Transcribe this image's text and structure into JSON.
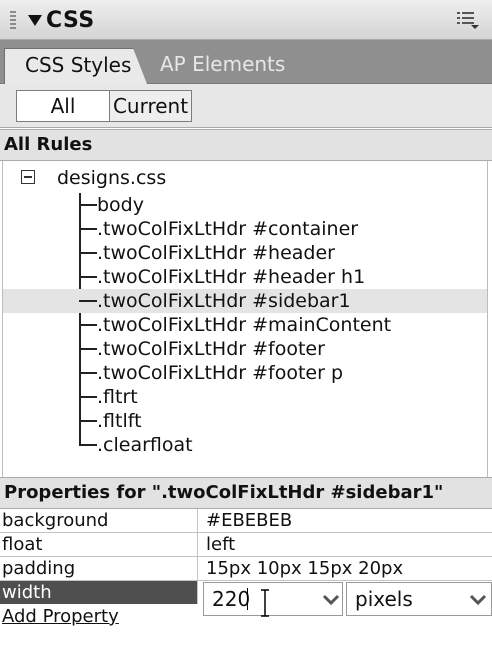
{
  "panel": {
    "title": "CSS"
  },
  "tabs": [
    {
      "label": "CSS Styles",
      "active": true
    },
    {
      "label": "AP Elements",
      "active": false
    }
  ],
  "mode_switch": {
    "all_label": "All",
    "current_label": "Current",
    "selected": "All"
  },
  "rules": {
    "header": "All Rules",
    "stylesheet": "designs.css",
    "items": [
      {
        "label": "body",
        "selected": false
      },
      {
        "label": ".twoColFixLtHdr #container",
        "selected": false
      },
      {
        "label": ".twoColFixLtHdr #header",
        "selected": false
      },
      {
        "label": ".twoColFixLtHdr #header h1",
        "selected": false
      },
      {
        "label": ".twoColFixLtHdr #sidebar1",
        "selected": true
      },
      {
        "label": ".twoColFixLtHdr #mainContent",
        "selected": false
      },
      {
        "label": ".twoColFixLtHdr #footer",
        "selected": false
      },
      {
        "label": ".twoColFixLtHdr #footer p",
        "selected": false
      },
      {
        "label": ".fltrt",
        "selected": false
      },
      {
        "label": ".fltlft",
        "selected": false
      },
      {
        "label": ".clearfloat",
        "selected": false
      }
    ]
  },
  "properties": {
    "header": "Properties for \".twoColFixLtHdr #sidebar1\"",
    "rows": [
      {
        "name": "background",
        "value": "#EBEBEB"
      },
      {
        "name": "float",
        "value": "left"
      },
      {
        "name": "padding",
        "value": "15px 10px 15px 20px"
      }
    ],
    "editing": {
      "name": "width",
      "value": "220",
      "unit": "pixels"
    },
    "add_label": "Add Property"
  },
  "colors": {
    "titlebar": "#dcdcdc",
    "tabs_bg": "#8f8f8f",
    "selected_row": "#e4e4e4",
    "active_property": "#4f4f4f"
  },
  "icons": [
    "panel-grip-icon",
    "collapse-triangle-icon",
    "panel-options-menu-icon",
    "tree-collapse-icon",
    "dropdown-chevron-icon",
    "text-ibeam-cursor-icon"
  ]
}
